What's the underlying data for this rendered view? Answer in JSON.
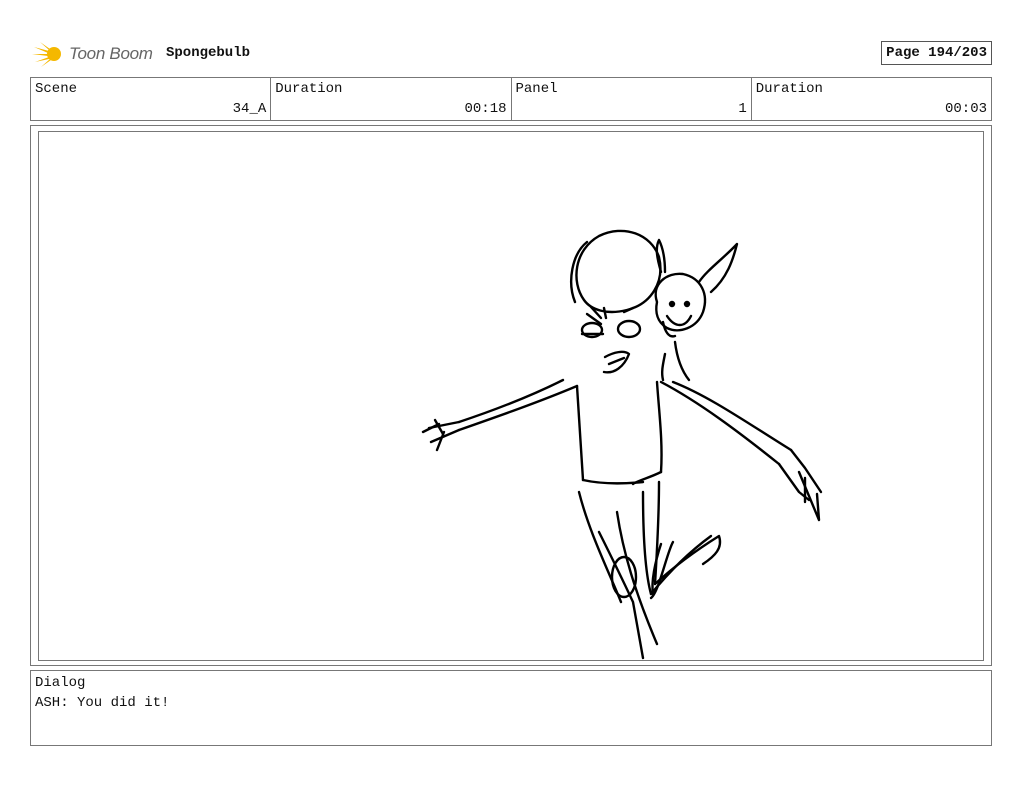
{
  "header": {
    "brand": "Toon Boom",
    "project_title": "Spongebulb",
    "page_label": "Page 194/203"
  },
  "info": {
    "scene_label": "Scene",
    "scene_value": "34_A",
    "scene_duration_label": "Duration",
    "scene_duration_value": "00:18",
    "panel_label": "Panel",
    "panel_value": "1",
    "panel_duration_label": "Duration",
    "panel_duration_value": "00:03"
  },
  "dialog": {
    "label": "Dialog",
    "text": "ASH: You did it!"
  },
  "colors": {
    "logo_accent": "#F5B800",
    "sketch_line": "#000000"
  }
}
